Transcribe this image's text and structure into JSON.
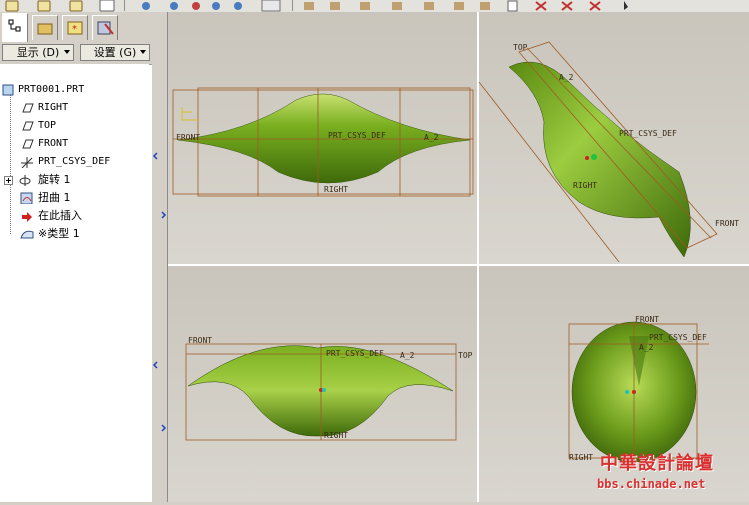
{
  "dropdowns": {
    "display": "显示 (D)",
    "settings": "设置 (G)"
  },
  "tree": {
    "root": "PRT0001.PRT",
    "items": [
      "RIGHT",
      "TOP",
      "FRONT",
      "PRT_CSYS_DEF",
      "旋转 1",
      "扭曲 1",
      "在此插入",
      "※类型 1"
    ]
  },
  "viewports": {
    "front": {
      "label_front": "FRONT",
      "label_csys": "PRT_CSYS_DEF",
      "label_right": "RIGHT",
      "label_a2": "A_2"
    },
    "iso": {
      "label_top": "TOP",
      "label_csys": "PRT_CSYS_DEF",
      "label_right": "RIGHT",
      "label_front": "FRONT",
      "label_a2": "A_2"
    },
    "top": {
      "label_front": "FRONT",
      "label_csys": "PRT_CSYS_DEF",
      "label_top": "TOP",
      "label_right": "RIGHT",
      "label_a2": "A_2"
    },
    "side": {
      "label_front": "FRONT",
      "label_csys": "PRT_CSYS_DEF",
      "label_right": "RIGHT",
      "label_a2": "A_2"
    }
  },
  "watermark": {
    "cn": "中華設計論壇",
    "url": "bbs.chinade.net"
  },
  "colors": {
    "surface": "#6a9a1a",
    "datum": "#a05a20",
    "highlight": "#d93030"
  }
}
